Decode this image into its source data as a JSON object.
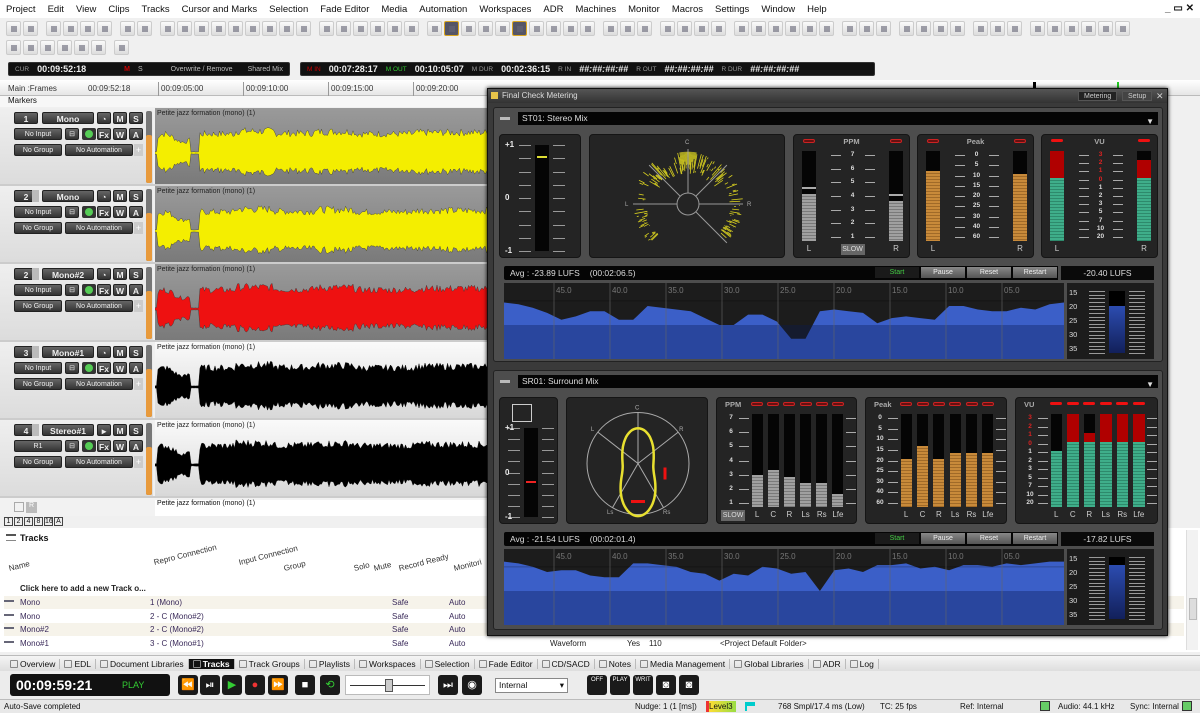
{
  "menu": [
    "Project",
    "Edit",
    "View",
    "Clips",
    "Tracks",
    "Cursor and Marks",
    "Selection",
    "Fade Editor",
    "Media",
    "Automation",
    "Workspaces",
    "ADR",
    "Machines",
    "Monitor",
    "Macros",
    "Settings",
    "Window",
    "Help"
  ],
  "window_controls": "_ ▭ ✕",
  "transport_info": {
    "cur_label": "CUR",
    "cur_time": "00:09:52:18",
    "rec_mode": "M",
    "solo": "S",
    "mode": "Overwrite / Remove",
    "mix": "Shared Mix",
    "m_in_label": "M IN",
    "m_in": "00:07:28:17",
    "m_out_label": "M OUT",
    "m_out": "00:10:05:07",
    "m_dur_label": "M DUR",
    "m_dur": "00:02:36:15",
    "r_in_label": "R IN",
    "r_in": "##:##:##:##",
    "r_out_label": "R OUT",
    "r_out": "##:##:##:##",
    "r_dur_label": "R DUR",
    "r_dur": "##:##:##:##"
  },
  "ruler": {
    "label": "Main :Frames",
    "cursor": "00:09:52:18",
    "ticks": [
      "00:09:05:00",
      "00:09:10:00",
      "00:09:15:00",
      "00:09:20:00"
    ]
  },
  "markers_label": "Markers",
  "tracks": [
    {
      "num": "1",
      "name": "Mono",
      "input": "No Input",
      "group": "No Group",
      "automation": "No Automation",
      "clip": "Petite jazz formation (mono) (1)",
      "color": "#f4ee00",
      "bg": "#8c8c8c",
      "selected": true
    },
    {
      "num": "2",
      "name": "Mono",
      "input": "No Input",
      "group": "No Group",
      "automation": "No Automation",
      "clip": "Petite jazz formation (mono) (1)",
      "color": "#f4ee00",
      "bg": "#8c8c8c",
      "selected": false
    },
    {
      "num": "2",
      "name": "Mono#2",
      "input": "No Input",
      "group": "No Group",
      "automation": "No Automation",
      "clip": "Petite jazz formation (mono) (1)",
      "color": "#ee1111",
      "bg": "#8c8c8c",
      "selected": false
    },
    {
      "num": "3",
      "name": "Mono#1",
      "input": "No Input",
      "group": "No Group",
      "automation": "No Automation",
      "clip": "Petite jazz formation (mono) (1)",
      "color": "#000000",
      "bg": "#e6e6e6",
      "selected": true
    },
    {
      "num": "4",
      "name": "Stereo#1",
      "input": "R1",
      "group": "No Group",
      "automation": "No Automation",
      "clip": "Petite jazz formation (mono) (1)",
      "color": "#000000",
      "bg": "#e6e6e6",
      "selected": false
    }
  ],
  "track_buttons": {
    "m": "M",
    "s": "S",
    "fx": "Fx",
    "w": "W",
    "a": "A",
    "plus": "+"
  },
  "extra_clip": "Petite jazz formation (mono) (1)",
  "zoom_buttons": [
    "1",
    "2",
    "4",
    "8",
    "16",
    "A"
  ],
  "metering": {
    "title": "Final Check Metering",
    "tabs": [
      "Metering",
      "Setup"
    ],
    "stereo": {
      "name": "ST01: Stereo Mix",
      "phase_labels": [
        "+1",
        "0",
        "-1"
      ],
      "phase_value": 0.8,
      "gonio_labels": [
        "C",
        "L",
        "R"
      ],
      "ppm": {
        "title": "PPM",
        "scale": [
          "7",
          "6",
          "5",
          "4",
          "3",
          "2",
          "1"
        ],
        "channels": [
          "L",
          "R"
        ],
        "levels": [
          0.52,
          0.44
        ],
        "peaks": [
          0.58,
          0.5
        ],
        "mode": "SLOW"
      },
      "peak": {
        "title": "Peak",
        "scale": [
          "0",
          "5",
          "10",
          "15",
          "20",
          "25",
          "30",
          "40",
          "60"
        ],
        "channels": [
          "L",
          "R"
        ],
        "levels": [
          0.78,
          0.74
        ]
      },
      "vu": {
        "title": "VU",
        "scale": [
          "3",
          "2",
          "1",
          "0",
          "1",
          "2",
          "3",
          "5",
          "7",
          "10",
          "20"
        ],
        "channels": [
          "L",
          "R"
        ],
        "levels": [
          1.0,
          0.9
        ]
      },
      "avg": "Avg : -23.89 LUFS",
      "duration": "(00:02:06.5)",
      "buttons": [
        "Start",
        "Pause",
        "Reset",
        "Restart"
      ],
      "lufs": "-20.40 LUFS",
      "graph_ticks": [
        "45.0",
        "40.0",
        "35.0",
        "30.0",
        "25.0",
        "20.0",
        "15.0",
        "10.0",
        "05.0"
      ],
      "side_scale": [
        "15",
        "20",
        "25",
        "30",
        "35"
      ],
      "history_lufs": [
        -19.5,
        -20,
        -21,
        -22.5,
        -24.5,
        -23.5,
        -22,
        -22,
        -24.5,
        -24.5,
        -20.5,
        -21,
        -21.5,
        -22,
        -24,
        -26,
        -26,
        -23,
        -23,
        -25,
        -30,
        -30,
        -22,
        -21.5,
        -22,
        -22.5,
        -25.5,
        -24,
        -23.5,
        -24,
        -24.5,
        -20.5,
        -20.5,
        -21.5,
        -22,
        -22,
        -21,
        -21.5,
        -20,
        -19.5
      ],
      "current_short_term": -20.4
    },
    "surround": {
      "name": "SR01: Surround Mix",
      "phase_labels": [
        "+1",
        "0",
        "-1"
      ],
      "phase_value": -0.2,
      "scope_labels": [
        "C",
        "L",
        "R",
        "Ls",
        "Rs"
      ],
      "ppm": {
        "title": "PPM",
        "scale": [
          "7",
          "6",
          "5",
          "4",
          "3",
          "2",
          "1"
        ],
        "channels": [
          "L",
          "C",
          "R",
          "Ls",
          "Rs",
          "Lfe"
        ],
        "levels": [
          0.34,
          0.4,
          0.32,
          0.26,
          0.26,
          0.14
        ],
        "mode": "SLOW"
      },
      "peak": {
        "title": "Peak",
        "scale": [
          "0",
          "5",
          "10",
          "15",
          "20",
          "25",
          "30",
          "40",
          "60"
        ],
        "channels": [
          "L",
          "C",
          "R",
          "Ls",
          "Rs",
          "Lfe"
        ],
        "levels": [
          0.52,
          0.66,
          0.52,
          0.58,
          0.58,
          0.58
        ]
      },
      "vu": {
        "title": "VU",
        "scale": [
          "3",
          "2",
          "1",
          "0",
          "1",
          "2",
          "3",
          "5",
          "7",
          "10",
          "20"
        ],
        "channels": [
          "L",
          "C",
          "R",
          "Ls",
          "Rs",
          "Lfe"
        ],
        "levels": [
          0.6,
          1.0,
          0.8,
          1.0,
          1.0,
          1.0
        ]
      },
      "avg": "Avg : -21.54 LUFS",
      "duration": "(00:02:01.4)",
      "buttons": [
        "Start",
        "Pause",
        "Reset",
        "Restart"
      ],
      "lufs": "-17.82 LUFS",
      "graph_ticks": [
        "45.0",
        "40.0",
        "35.0",
        "30.0",
        "25.0",
        "20.0",
        "15.0",
        "10.0",
        "05.0"
      ],
      "side_scale": [
        "15",
        "20",
        "25",
        "30",
        "35"
      ],
      "history_lufs": [
        -17.5,
        -18,
        -19,
        -20.5,
        -20,
        -20,
        -21.5,
        -22,
        -22,
        -18,
        -18,
        -18.5,
        -19,
        -20.5,
        -21,
        -23,
        -21,
        -21.5,
        -19,
        -19.5,
        -21,
        -20.5,
        -26,
        -20,
        -19.5,
        -20.5,
        -18.5,
        -18.5,
        -18,
        -19.5,
        -19,
        -20,
        -18.5,
        -18.5,
        -19,
        -18,
        -18.5,
        -18,
        -17.5,
        -17.5
      ],
      "current_short_term": -17.8
    }
  },
  "tracks_panel": {
    "title": "Tracks",
    "columns": [
      "Name",
      "Repro Connection",
      "Input Connection",
      "Group",
      "Solo",
      "Mute",
      "Record Ready",
      "Monitori"
    ],
    "add_row": "Click here to add a new Track o...",
    "rows": [
      {
        "name": "Mono",
        "repro": "1 (Mono)",
        "record": "Safe",
        "monitor": "Auto"
      },
      {
        "name": "Mono",
        "repro": "2 - C (Mono#2)",
        "record": "Safe",
        "monitor": "Auto"
      },
      {
        "name": "Mono#2",
        "repro": "2 - C (Mono#2)",
        "record": "Safe",
        "monitor": "Auto"
      },
      {
        "name": "Mono#1",
        "repro": "3 - C (Mono#1)",
        "record": "Safe",
        "monitor": "Auto",
        "extra": [
          "Waveform",
          "Yes",
          "110",
          "<Project Default Folder>"
        ]
      }
    ]
  },
  "bottom_tabs": [
    "Overview",
    "EDL",
    "Document Libraries",
    "Tracks",
    "Track Groups",
    "Playlists",
    "Workspaces",
    "Selection",
    "Fade Editor",
    "CD/SACD",
    "Notes",
    "Media Management",
    "Global Libraries",
    "ADR",
    "Log"
  ],
  "selected_tab": "Tracks",
  "transport": {
    "time": "00:09:59:21",
    "state": "PLAY",
    "sync_source": "Internal",
    "jog_position": 0.5,
    "mode_buttons": [
      "OFF",
      "PLAY",
      "WRIT"
    ]
  },
  "status": {
    "message": "Auto-Save completed",
    "nudge": "Nudge: 1 (1 [ms])",
    "level": "Level3",
    "buffer": "768 Smpl/17.4 ms (Low)",
    "tc": "TC: 25 fps",
    "ref": "Ref: Internal",
    "audio": "Audio: 44.1 kHz",
    "sync": "Sync: Internal"
  },
  "colors": {
    "yellow": "#f4ee00",
    "red": "#ee1111",
    "ppm": "#9a9a9a",
    "peak": "#c88a3a",
    "vu_green": "#3fae8a",
    "vu_red": "#b00000",
    "loudness": "#3a5cc0"
  }
}
